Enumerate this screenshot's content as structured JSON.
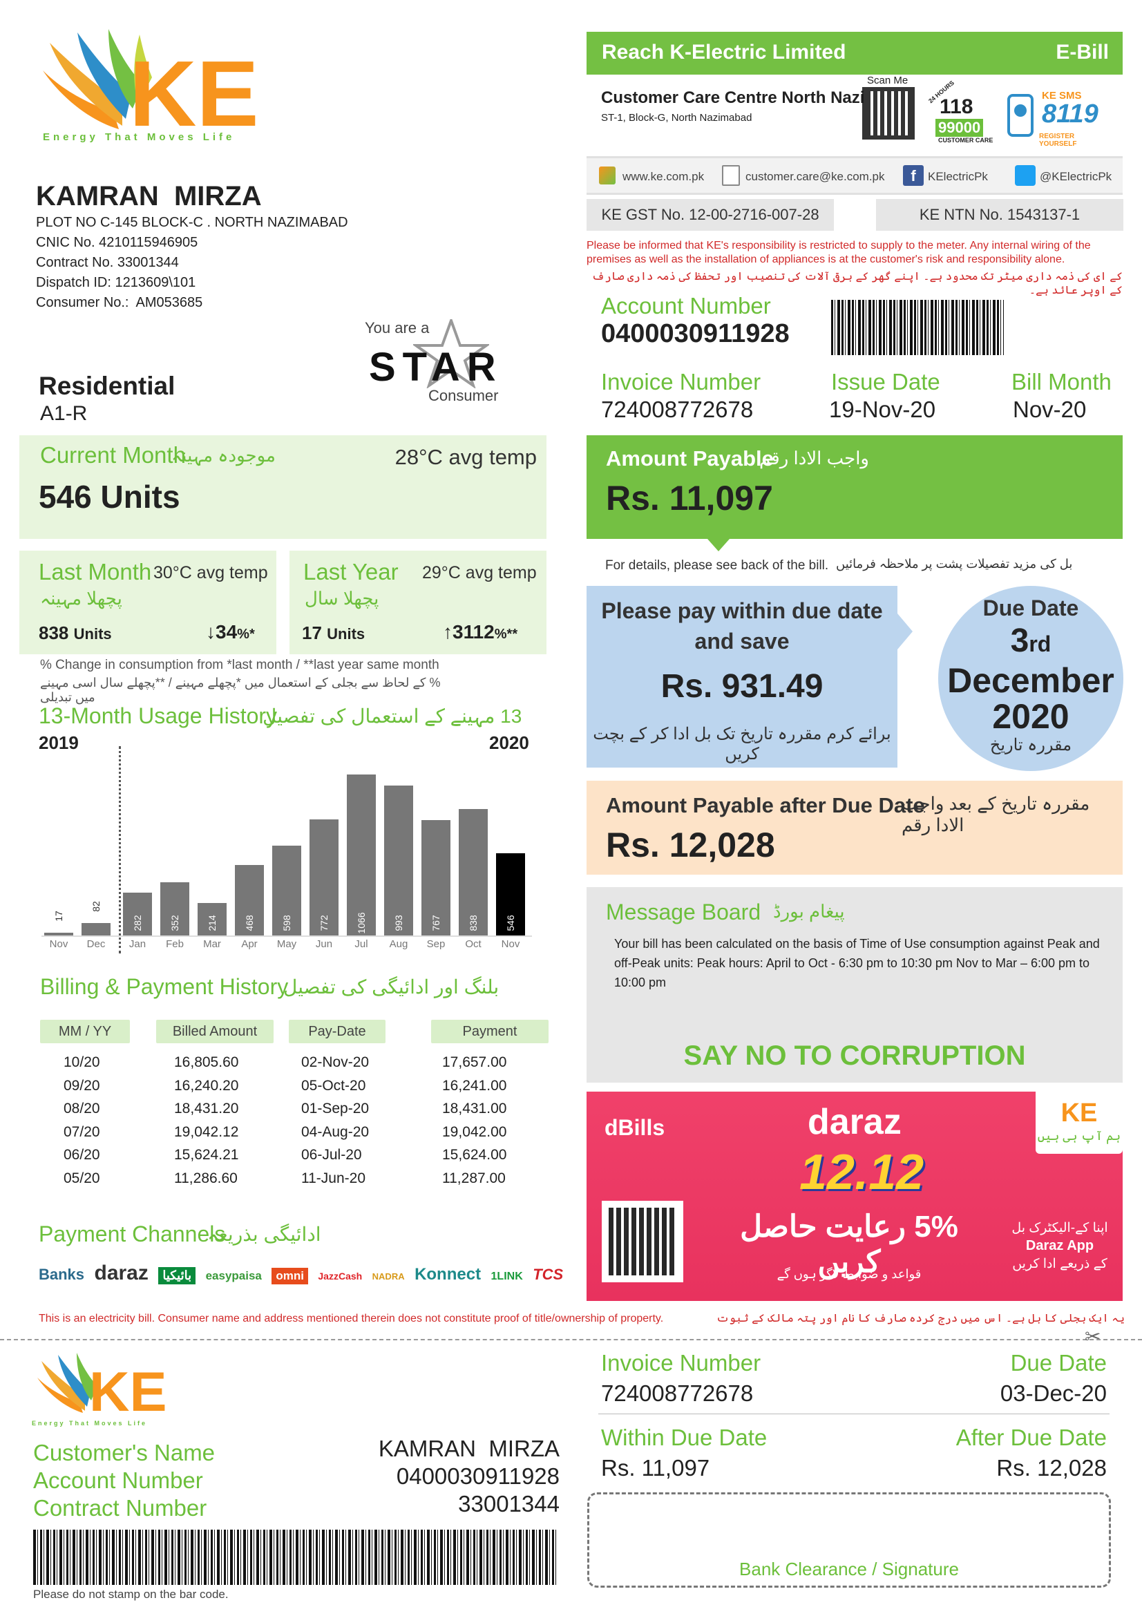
{
  "brand": {
    "logo": "KE",
    "tagline": "Energy That Moves Life",
    "accent": "#f7941d",
    "green": "#74c043"
  },
  "customer": {
    "name": "KAMRAN  MIRZA",
    "address": "PLOT NO C-145 BLOCK-C . NORTH NAZIMABAD",
    "cnic": "CNIC No. 4210115946905",
    "contract": "Contract No. 33001344",
    "dispatch": "Dispatch ID: 1213609\\101",
    "consumer": "Consumer No.:  AM053685",
    "type": "Residential",
    "tariff": "A1-R"
  },
  "star": {
    "you_are": "You are a",
    "star": "STAR",
    "consumer": "Consumer"
  },
  "header": {
    "company": "Reach K-Electric Limited",
    "ebill": "E-Bill",
    "centre": "Customer Care Centre North Nazimabad",
    "centre_addr": "ST-1, Block-G, North Nazimabad",
    "scan": "Scan Me",
    "helpline_hours": "24 HOURS",
    "helpline_118": "118",
    "helpline_99000": "99000",
    "helpline_label": "CUSTOMER CARE",
    "sms_ke": "KE SMS",
    "sms_number": "8119",
    "sms_register": "REGISTER YOURSELF",
    "web": "www.ke.com.pk",
    "email": "customer.care@ke.com.pk",
    "fb": "KElectricPk",
    "tw": "@KElectricPk",
    "gst": "KE GST No. 12-00-2716-007-28",
    "ntn": "KE NTN No. 1543137-1",
    "notice": "Please be informed that KE's responsibility is restricted to supply to the meter. Any internal wiring of the premises as well as the installation of appliances is at the customer's risk and responsibility alone.",
    "notice_ur": "کے ای کی ذمہ داری میٹر تک محدود ہے۔ اپنے گھر کے برقی آلات کی تنصیب اور تحفظ کی ذمہ داری صارف کے اوپر عائد ہے۔"
  },
  "account": {
    "label": "Account Number",
    "number": "0400030911928",
    "invoice_label": "Invoice Number",
    "invoice": "724008772678",
    "issue_label": "Issue Date",
    "issue": "19-Nov-20",
    "month_label": "Bill Month",
    "month": "Nov-20"
  },
  "current": {
    "label": "Current Month",
    "label_ur": "موجودہ مہینہ",
    "temp": "28°C avg temp",
    "units": "546 Units"
  },
  "last_month": {
    "label": "Last Month",
    "label_ur": "پچھلا مہینہ",
    "temp": "30°C avg temp",
    "units": "838",
    "units_label": "Units",
    "change": "34",
    "change_suffix": "%*"
  },
  "last_year": {
    "label": "Last Year",
    "label_ur": "پچھلا سال",
    "temp": "29°C avg temp",
    "units": "17",
    "units_label": "Units",
    "change": "3112",
    "change_suffix": "%**"
  },
  "change_note": "% Change in consumption from *last month / **last year same month",
  "change_note_ur": "% کے لحاظ سے بجلی کے استعمال میں *پچھلے مہینے / **پچھلے سال اسی مہینے میں تبدیلی",
  "history_title": "13-Month Usage History",
  "history_title_ur": "13 مہینے کے استعمال کی تفصیل",
  "chart_data": {
    "type": "bar",
    "categories": [
      "Nov",
      "Dec",
      "Jan",
      "Feb",
      "Mar",
      "Apr",
      "May",
      "Jun",
      "Jul",
      "Aug",
      "Sep",
      "Oct",
      "Nov"
    ],
    "values": [
      17,
      82,
      282,
      352,
      214,
      468,
      598,
      772,
      1066,
      993,
      767,
      838,
      546
    ],
    "year_left": "2019",
    "year_right": "2020",
    "ylim": [
      0,
      1100
    ],
    "colors": {
      "bar": "#777777",
      "current": "#000000"
    }
  },
  "billing": {
    "title": "Billing & Payment History",
    "title_ur": "بلنگ اور ادائیگی کی تفصیل",
    "headers": [
      "MM / YY",
      "Billed Amount",
      "Pay-Date",
      "Payment"
    ],
    "rows": [
      [
        "10/20",
        "16,805.60",
        "02-Nov-20",
        "17,657.00"
      ],
      [
        "09/20",
        "16,240.20",
        "05-Oct-20",
        "16,241.00"
      ],
      [
        "08/20",
        "18,431.20",
        "01-Sep-20",
        "18,431.00"
      ],
      [
        "07/20",
        "19,042.12",
        "04-Aug-20",
        "19,042.00"
      ],
      [
        "06/20",
        "15,624.21",
        "06-Jul-20",
        "15,624.00"
      ],
      [
        "05/20",
        "11,286.60",
        "11-Jun-20",
        "11,287.00"
      ]
    ]
  },
  "payment": {
    "title": "Payment Channels",
    "title_ur": "ادائیگی بذریعہ",
    "channels": [
      "Banks",
      "daraz",
      "بائیکیا",
      "easypaisa",
      "omni",
      "JazzCash",
      "NADRA",
      "Konnect",
      "1LINK",
      "TCS"
    ]
  },
  "amount_payable": {
    "label": "Amount Payable",
    "label_ur": "واجب الادا رقم",
    "value": "Rs. 11,097"
  },
  "details_note": "For details, please see back of the bill.",
  "details_note_ur": "بل کی مزید تفصیلات پشت پر ملاحظہ فرمائیں",
  "save": {
    "line1": "Please pay within due date",
    "line2": "and save",
    "amount": "Rs. 931.49",
    "ur": "برائے کرم مقررہ تاریخ تک بل ادا کر کے بچت کریں"
  },
  "due": {
    "label": "Due Date",
    "day": "3",
    "suffix": "rd",
    "month": "December",
    "year": "2020",
    "ur": "مقررہ تاریخ"
  },
  "after_due": {
    "label": "Amount Payable after Due Date",
    "label_ur": "مقررہ تاریخ کے بعد واجب الادا رقم",
    "value": "Rs. 12,028"
  },
  "message": {
    "title": "Message Board",
    "title_ur": "پیغام بورڈ",
    "text": "Your bill has been calculated on the basis of Time of Use consumption against Peak and off-Peak units: Peak hours: April to Oct - 6:30 pm to 10:30 pm Nov to Mar – 6:00 pm to 10:00 pm",
    "slogan": "SAY NO TO CORRUPTION"
  },
  "promo": {
    "dbills": "dBills",
    "daraz": "daraz",
    "sale": "12.12",
    "discount_ur": "5% رعایت حاصل کریں",
    "terms_ur": "قواعد و ضوابط لاگو ہوں گے",
    "ke_ur": "ہم آپ ہی ہیں",
    "right_ur1": "اپنا کے-الیکٹرک بل",
    "right_app": "Daraz App",
    "right_ur2": "کے ذریعے ادا کریں"
  },
  "disclaimer": "This is an electricity bill. Consumer name and address mentioned therein does not constitute proof of title/ownership of property.",
  "disclaimer_ur": "یہ ایک بجلی کا بل ہے۔ اس میں درج کردہ صارف کا نام اور پتہ مالک کے ثبوت اور پراپرٹی کی ملکیت کا قانونی جواز فراہم نہیں کرتا ہے۔",
  "stub": {
    "name_label": "Customer's Name",
    "name": "KAMRAN  MIRZA",
    "account_label": "Account Number",
    "account": "0400030911928",
    "contract_label": "Contract Number",
    "contract": "33001344",
    "barcode_note": "Please do not stamp on the bar code.",
    "invoice_label": "Invoice Number",
    "invoice": "724008772678",
    "due_label": "Due Date",
    "due": "03-Dec-20",
    "within_label": "Within Due Date",
    "within": "Rs. 11,097",
    "after_label": "After Due Date",
    "after": "Rs. 12,028",
    "bank": "Bank Clearance / Signature"
  }
}
